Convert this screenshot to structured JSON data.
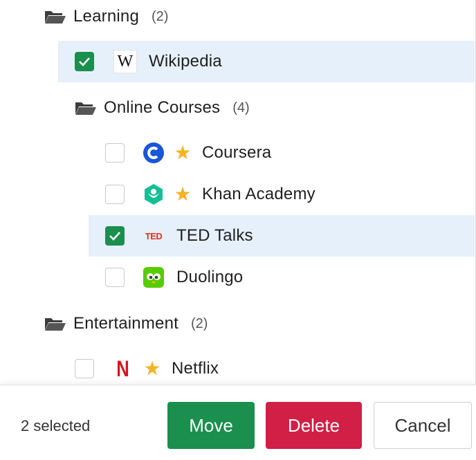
{
  "tree": {
    "learning": {
      "label": "Learning",
      "count": "(2)"
    },
    "wikipedia": {
      "label": "Wikipedia",
      "checked": true,
      "logo_text": "W"
    },
    "online_courses": {
      "label": "Online Courses",
      "count": "(4)"
    },
    "coursera": {
      "label": "Coursera",
      "checked": false,
      "starred": true,
      "star": "★"
    },
    "khan": {
      "label": "Khan Academy",
      "checked": false,
      "starred": true,
      "star": "★"
    },
    "ted": {
      "label": "TED Talks",
      "checked": true,
      "logo_text": "TED"
    },
    "duolingo": {
      "label": "Duolingo",
      "checked": false
    },
    "entertainment": {
      "label": "Entertainment",
      "count": "(2)"
    },
    "netflix": {
      "label": "Netflix",
      "checked": false,
      "starred": true,
      "star": "★",
      "logo_text": "N"
    }
  },
  "footer": {
    "selected_text": "2 selected",
    "move_label": "Move",
    "delete_label": "Delete",
    "cancel_label": "Cancel"
  },
  "colors": {
    "accent_green": "#1a8f4e",
    "danger_red": "#d11f46",
    "selected_row": "#e6f0fb",
    "star_yellow": "#f5b324"
  }
}
